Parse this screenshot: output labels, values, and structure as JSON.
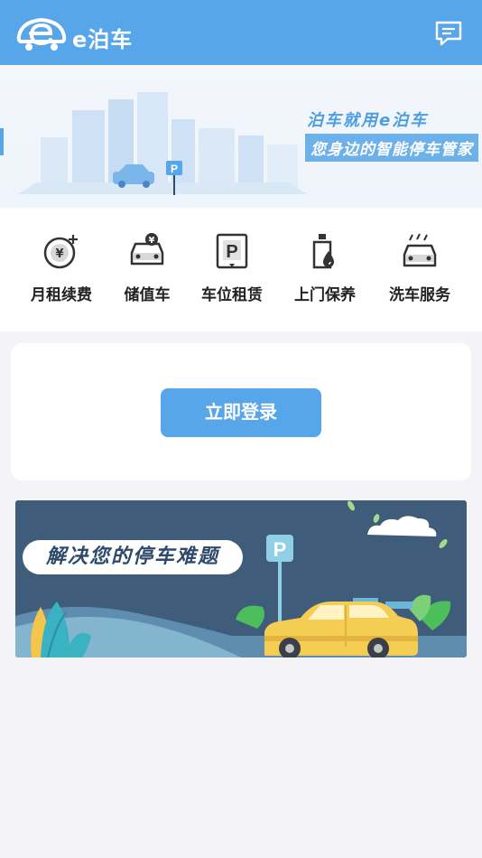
{
  "header": {
    "title": "e泊车",
    "logo_icon": "e-car-logo-icon",
    "message_icon": "message-icon"
  },
  "banner": {
    "slogan_line1": "泊车就用e泊车",
    "slogan_line2": "您身边的智能停车管家",
    "parking_sign": "P"
  },
  "services": [
    {
      "label": "月租续费",
      "icon": "monthly-renewal-icon"
    },
    {
      "label": "储值车",
      "icon": "stored-value-car-icon"
    },
    {
      "label": "车位租赁",
      "icon": "parking-space-icon"
    },
    {
      "label": "上门保养",
      "icon": "maintenance-icon"
    },
    {
      "label": "洗车服务",
      "icon": "car-wash-icon"
    }
  ],
  "login": {
    "button_label": "立即登录"
  },
  "promo": {
    "title": "解决您的停车难题",
    "parking_sign": "P"
  },
  "colors": {
    "primary": "#58a6ea",
    "promo_bg": "#3f5c7a",
    "car": "#f5cd52"
  }
}
